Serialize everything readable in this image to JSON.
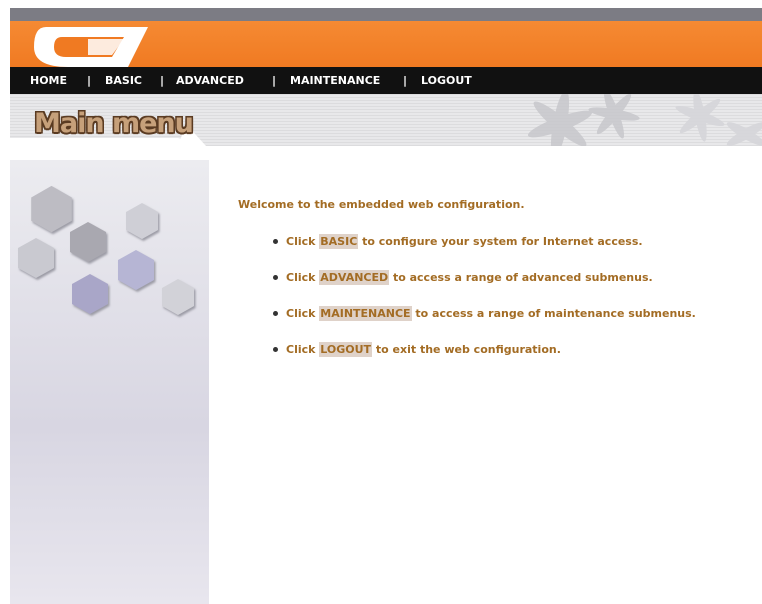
{
  "nav": {
    "home": "HOME",
    "basic": "BASIC",
    "advanced": "ADVANCED",
    "maintenance": "MAINTENANCE",
    "logout": "LOGOUT",
    "separator": "|"
  },
  "page": {
    "title": "Main menu"
  },
  "content": {
    "welcome": "Welcome to the embedded web configuration.",
    "items": [
      {
        "prefix": "Click ",
        "link": "BASIC",
        "suffix": " to configure your system for Internet access."
      },
      {
        "prefix": "Click ",
        "link": "ADVANCED",
        "suffix": " to access a range of advanced submenus."
      },
      {
        "prefix": "Click ",
        "link": "MAINTENANCE",
        "suffix": " to access a range of maintenance submenus."
      },
      {
        "prefix": "Click ",
        "link": "LOGOUT",
        "suffix": " to exit the web configuration."
      }
    ]
  },
  "colors": {
    "header_orange": "#f58a33",
    "nav_black": "#111111",
    "text_brown": "#a36c24",
    "link_highlight": "#dfd2c9"
  },
  "icons": {
    "logo": "logo-icon",
    "decoration": "flowers-icon",
    "sidebar": "hexagons-icon",
    "bullet": "bullet-icon"
  }
}
